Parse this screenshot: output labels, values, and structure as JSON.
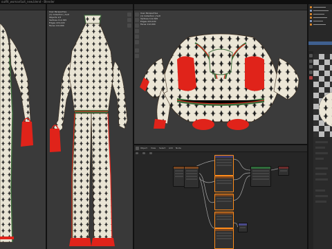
{
  "window": {
    "title": "outfit_womanSuit_new.blend - Blender"
  },
  "viewport_left": {
    "overlay": [
      "User Perspective",
      "(1) Collection | Suit",
      "Objects 1/3",
      "Vertices 112,345",
      "Edges 224,100",
      "Faces 112,004",
      "Triangles 224,008"
    ]
  },
  "viewport_center": {
    "overlay": [
      "User Perspective",
      "(1) Collection | Suit",
      "Objects 1/3",
      "Vertices 112,345",
      "Edges 224,100",
      "Faces 112,004",
      "Triangles 224,008"
    ]
  },
  "node_editor": {
    "header_items": [
      "Object",
      "View",
      "Select",
      "Add",
      "Node",
      "Use Nodes",
      "Slot 1",
      "Suit"
    ]
  },
  "colors": {
    "accent": "#ff8c1a",
    "fabric": "#e9e4d4",
    "pattern": "#2a2a2a",
    "red": "#e0231a",
    "green_band": "#3c6b3a"
  }
}
